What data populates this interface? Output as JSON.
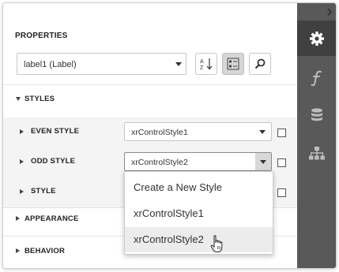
{
  "panel": {
    "title": "PROPERTIES",
    "object_selector": {
      "value": "label1 (Label)"
    }
  },
  "toolbar": {
    "sort_icon": "sort-alpha-icon",
    "categories_icon": "categorized-list-icon",
    "search_icon": "search-icon"
  },
  "sections": {
    "styles": "STYLES",
    "appearance": "APPEARANCE",
    "behavior": "BEHAVIOR"
  },
  "properties": [
    {
      "label": "EVEN STYLE",
      "value": "xrControlStyle1"
    },
    {
      "label": "ODD STYLE",
      "value": "xrControlStyle2"
    },
    {
      "label": "STYLE",
      "value": ""
    }
  ],
  "dropdown": {
    "items": [
      "Create a New Style",
      "xrControlStyle1",
      "xrControlStyle2"
    ],
    "hovered_index": 2
  },
  "sidebar_tabs": [
    "gear-icon",
    "function-icon",
    "database-icon",
    "hierarchy-icon"
  ],
  "colors": {
    "sidebar_bg": "#595959",
    "sidebar_active": "#404040",
    "row_bg": "#f4f4f4"
  }
}
